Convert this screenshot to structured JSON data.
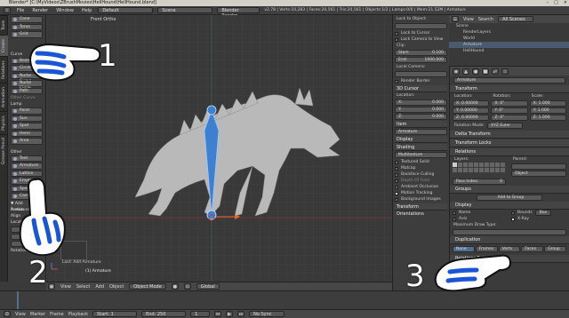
{
  "title": "Blender* [C:\\MyVideos\\ZBrushMovies\\HellHound\\HellHound.blend]",
  "window_controls": [
    "–",
    "□",
    "×"
  ],
  "info": {
    "menus": [
      "File",
      "Render",
      "Window",
      "Help"
    ],
    "layout": "Default",
    "scene": "Scene",
    "engine": "Blender Render",
    "stats": "v2.78 | Verts:10,283 | Faces:20,561 | Tris:20,561 | Objects:1/2 | Lamps:0/0 | Mem:21.52M | Armature"
  },
  "tabs": [
    "Tools",
    "Create",
    "Relations",
    "Animation",
    "Physics",
    "Grease Pencil"
  ],
  "tools": {
    "top": [
      "Cone",
      "Torus",
      "Grid"
    ],
    "curve_heading": "Curve",
    "curve": [
      "Bezier",
      "Circle",
      "Nurbs Curve",
      "Nurbs Circle",
      "Path"
    ],
    "other_row": "Other Curve",
    "lamp_heading": "Lamp",
    "lamp": [
      "Point",
      "Sun",
      "Spot",
      "Hemi",
      "Area"
    ],
    "other_heading": "Other",
    "other": [
      "Text",
      "Armature",
      "Lattice",
      "Empty",
      "Speaker",
      "Camera"
    ],
    "add_label": "▼ Add Armature",
    "radius_label": "Radius",
    "align_label": "Align",
    "location_label": "Location",
    "rotation_label": "Rotation"
  },
  "viewport": {
    "label": "Front Ortho",
    "status": "(1) Armature",
    "last_op": "Last: Add Armature"
  },
  "vp_header": [
    "View",
    "Select",
    "Add",
    "Object",
    "Object Mode",
    "Global"
  ],
  "npanel": {
    "lock_heading": "Lock to Object:",
    "lock_cursor": "Lock to Cursor",
    "lock_camera": "Lock Camera to View",
    "clip": "Clip:",
    "clip_start_label": "Start:",
    "clip_start": "0.100",
    "clip_end_label": "End:",
    "clip_end": "1000.000",
    "local_camera": "Local Camera:",
    "render_border": "Render Border",
    "cursor_heading": "3D Cursor",
    "cursor_location": "Location:",
    "cursor_x_label": "X:",
    "cursor_x": "0.000",
    "cursor_y_label": "Y:",
    "cursor_y": "0.000",
    "cursor_z_label": "Z:",
    "cursor_z": "0.000",
    "item_heading": "Item",
    "item_name": "Armature",
    "display": "Display",
    "shading": "Shading",
    "shading_mode": "Multitexture",
    "shading_opts": [
      "Textured Solid",
      "Matcap",
      "Backface Culling",
      "Depth Of Field",
      "Ambient Occlusion"
    ],
    "motion_tracking": "Motion Tracking",
    "background_images": "Background Images",
    "transform_orientations": "Transform Orientations"
  },
  "outliner": {
    "menus": [
      "View",
      "Search"
    ],
    "filter": "All Scenes",
    "items": [
      "Scene",
      "RenderLayers",
      "World",
      "Armature",
      "HellHound"
    ]
  },
  "props": {
    "object_name": "Armature",
    "transform": "Transform",
    "location_label": "Location:",
    "rotation_label": "Rotation:",
    "scale_label": "Scale:",
    "loc": [
      "X: 0.00000",
      "Y: 0.00000",
      "Z: 0.00000"
    ],
    "rot": [
      "X: 0°",
      "Y: 0°",
      "Z: 0°"
    ],
    "scale": [
      "X: 1.000",
      "Y: 1.000",
      "Z: 1.000"
    ],
    "rotation_mode_label": "Rotation Mode:",
    "rotation_mode": "XYZ Euler",
    "delta": "Delta Transform",
    "locks": "Transform Locks",
    "relations": "Relations",
    "layers_label": "Layers:",
    "parent_label": "Parent:",
    "parent_type": "Object",
    "pass_index": "Pass Index:",
    "pass_index_val": "0",
    "groups": "Groups",
    "add_to_group": "Add to Group",
    "display": "Display",
    "name_label": "Name",
    "axis_label": "Axis",
    "bounds_label": "Bounds",
    "bounds_type": "Box",
    "xray_label": "X-Ray",
    "max_draw_label": "Maximum Draw Type:",
    "duplication": "Duplication",
    "dup_opts": [
      "None",
      "Frames",
      "Verts",
      "Faces",
      "Group"
    ],
    "relations_extras": "Relations Extras"
  },
  "timeline": {
    "menus": [
      "View",
      "Marker",
      "Frame",
      "Playback"
    ],
    "start": "Start: 1",
    "end": "End: 250",
    "frame": "1",
    "sync": "No Sync"
  },
  "callouts": [
    "1",
    "2",
    "3"
  ]
}
